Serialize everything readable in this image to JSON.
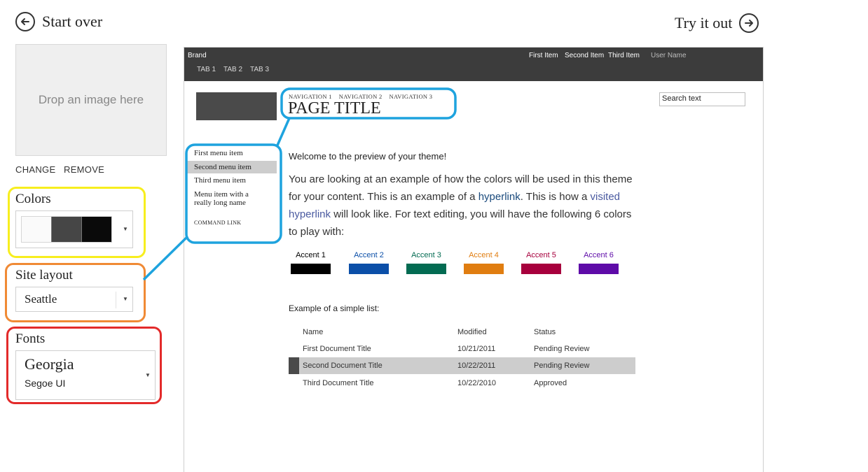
{
  "header": {
    "start_over": "Start over",
    "try_it_out": "Try it out"
  },
  "image": {
    "drop_text": "Drop an image here",
    "change": "CHANGE",
    "remove": "REMOVE"
  },
  "colors_panel": {
    "title": "Colors",
    "swatches": [
      "#fafafa",
      "#464646",
      "#0a0a0a"
    ],
    "highlight": "#f7ee1e"
  },
  "layout_panel": {
    "title": "Site layout",
    "value": "Seattle",
    "highlight": "#f08a35"
  },
  "fonts_panel": {
    "title": "Fonts",
    "heading_font": "Georgia",
    "body_font": "Segoe UI",
    "highlight": "#e32a2a"
  },
  "callout_color": "#1ea3de",
  "preview": {
    "brand": "Brand",
    "top_links": [
      "First Item",
      "Second Item",
      "Third Item"
    ],
    "user_name": "User Name",
    "tabs": [
      "TAB 1",
      "TAB 2",
      "TAB 3"
    ],
    "breadcrumb": [
      "NAVIGATION 1",
      "NAVIGATION 2",
      "NAVIGATION 3"
    ],
    "page_title": "PAGE TITLE",
    "search_text": "Search text",
    "menu": {
      "items": [
        "First menu item",
        "Second menu item",
        "Third menu item",
        "Menu item with a really long name"
      ],
      "selected_index": 1,
      "command_link": "COMMAND LINK"
    },
    "welcome": "Welcome to the preview of your theme!",
    "body": {
      "part1": "You are looking at an example of how the colors will be used in this theme for your content. This is an example of a ",
      "hyperlink": "hyperlink",
      "part2": ". This is how a ",
      "visited": "visited hyperlink",
      "part3": " will look like. For text editing, you will have the following 6 colors to play with:"
    },
    "accents": [
      {
        "label": "Accent 1",
        "color": "#000000",
        "text_color": "#000000"
      },
      {
        "label": "Accent 2",
        "color": "#0b4fa8",
        "text_color": "#0b4fa8"
      },
      {
        "label": "Accent 3",
        "color": "#036b52",
        "text_color": "#036b52"
      },
      {
        "label": "Accent 4",
        "color": "#e07d10",
        "text_color": "#e07d10"
      },
      {
        "label": "Accent 5",
        "color": "#a7003d",
        "text_color": "#a7003d"
      },
      {
        "label": "Accent 6",
        "color": "#5e0ba8",
        "text_color": "#5e0ba8"
      }
    ],
    "list": {
      "caption": "Example of a simple list:",
      "columns": [
        "Name",
        "Modified",
        "Status"
      ],
      "rows": [
        {
          "name": "First Document Title",
          "modified": "10/21/2011",
          "status": "Pending Review"
        },
        {
          "name": "Second Document Title",
          "modified": "10/22/2011",
          "status": "Pending Review"
        },
        {
          "name": "Third Document Title",
          "modified": "10/22/2010",
          "status": "Approved"
        }
      ],
      "selected_index": 1
    }
  }
}
